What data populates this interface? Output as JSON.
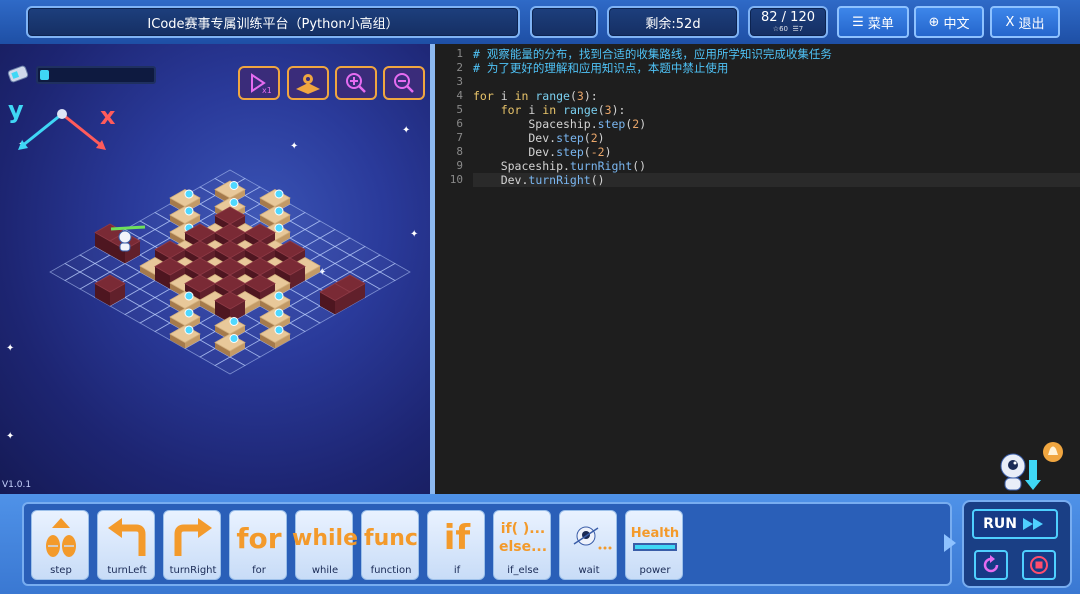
{
  "header": {
    "title": "ICode赛事专属训练平台（Python小高组）",
    "blank_label": "",
    "remaining": "剩余:52d",
    "progress_main": "82 / 120",
    "progress_sub_a": "60",
    "progress_sub_b": "7",
    "menu_label": "菜单",
    "lang_label": "中文",
    "exit_label": "退出"
  },
  "game": {
    "axis_y": "y",
    "axis_x": "x",
    "energy_level_percent": 8,
    "version": "V1.0.1",
    "tools": [
      "speed-icon",
      "map-icon",
      "zoom-in-icon",
      "zoom-out-icon"
    ]
  },
  "editor": {
    "lines": [
      {
        "n": "1",
        "text": "# 观察能量的分布，找到合适的收集路线，应用所学知识完成收集任务"
      },
      {
        "n": "2",
        "text": "# 为了更好的理解和应用知识点，本题中禁止使用"
      },
      {
        "n": "3",
        "text": ""
      },
      {
        "n": "4",
        "text": "for i in range(3):"
      },
      {
        "n": "5",
        "text": "    for i in range(3):"
      },
      {
        "n": "6",
        "text": "        Spaceship.step(2)"
      },
      {
        "n": "7",
        "text": "        Dev.step(2)"
      },
      {
        "n": "8",
        "text": "        Dev.step(-2)"
      },
      {
        "n": "9",
        "text": "    Spaceship.turnRight()"
      },
      {
        "n": "10",
        "text": "    Dev.turnRight()"
      }
    ]
  },
  "blocks": [
    {
      "icon": "step-icon",
      "label": "step"
    },
    {
      "icon": "turn-left-icon",
      "label": "turnLeft"
    },
    {
      "icon": "turn-right-icon",
      "label": "turnRight"
    },
    {
      "icon": "for-icon",
      "art": "for",
      "label": "for"
    },
    {
      "icon": "while-icon",
      "art": "while",
      "label": "while"
    },
    {
      "icon": "func-icon",
      "art": "func",
      "label": "function"
    },
    {
      "icon": "if-icon",
      "art": "if",
      "label": "if"
    },
    {
      "icon": "if-else-icon",
      "art_a": "if( )...",
      "art_b": "else...",
      "label": "if_else"
    },
    {
      "icon": "wait-icon",
      "label": "wait"
    },
    {
      "icon": "health-icon",
      "art": "Health",
      "label": "power"
    }
  ],
  "run": {
    "label": "RUN"
  },
  "colors": {
    "accent": "#3fd7f5",
    "block_text": "#f39a2b",
    "header": "#2f6ac7"
  }
}
